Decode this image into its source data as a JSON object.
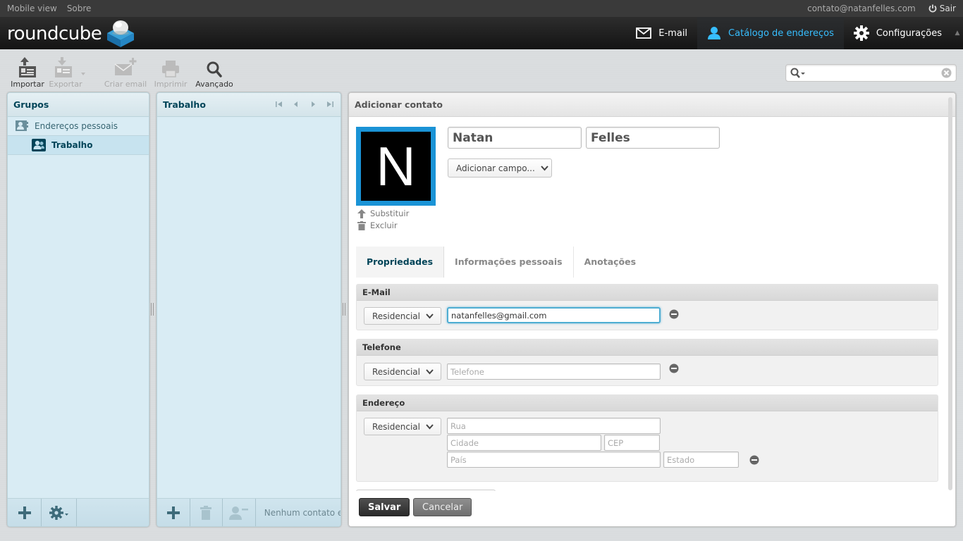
{
  "topline": {
    "mobile_view": "Mobile view",
    "about": "Sobre",
    "user": "contato@natanfelles.com",
    "logout": "Sair"
  },
  "logo": {
    "text": "roundcube"
  },
  "nav": {
    "email": "E-mail",
    "addressbook": "Catálogo de endereços",
    "settings": "Configurações"
  },
  "toolbar": {
    "import": "Importar",
    "export": "Exportar",
    "compose": "Criar email",
    "print": "Imprimir",
    "advanced": "Avançado"
  },
  "search": {
    "value": ""
  },
  "groups": {
    "title": "Grupos",
    "items": [
      {
        "label": "Endereços pessoais"
      },
      {
        "label": "Trabalho"
      }
    ]
  },
  "list": {
    "title": "Trabalho",
    "status": "Nenhum contato e"
  },
  "contact": {
    "title": "Adicionar contato",
    "photo_letter": "N",
    "replace": "Substituir",
    "delete": "Excluir",
    "firstname": "Natan",
    "surname": "Felles",
    "add_field": "Adicionar campo...",
    "tabs": [
      "Propriedades",
      "Informações pessoais",
      "Anotações"
    ],
    "email": {
      "legend": "E-Mail",
      "type": "Residencial",
      "value": "natanfelles@gmail.com"
    },
    "phone": {
      "legend": "Telefone",
      "type": "Residencial",
      "placeholder": "Telefone"
    },
    "address": {
      "legend": "Endereço",
      "type": "Residencial",
      "street_ph": "Rua",
      "city_ph": "Cidade",
      "zip_ph": "CEP",
      "country_ph": "País",
      "state_ph": "Estado"
    },
    "save": "Salvar",
    "cancel": "Cancelar"
  },
  "colors": {
    "accent": "#37beff",
    "photo_border": "#1a93d6",
    "panel_header": "#004458"
  }
}
